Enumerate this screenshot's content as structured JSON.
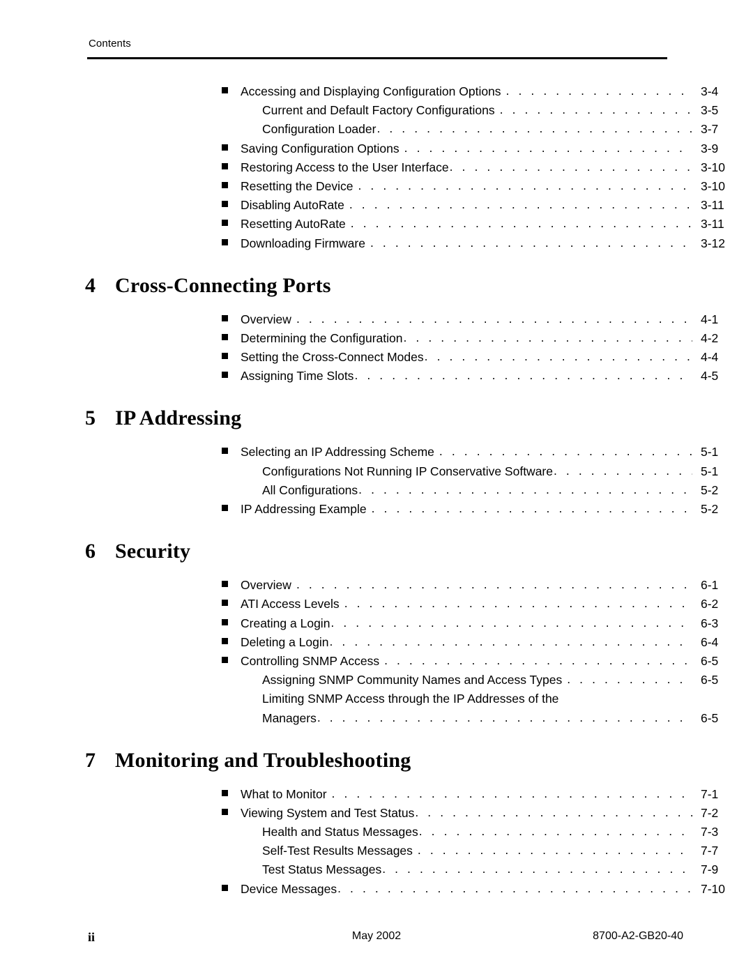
{
  "header": {
    "running_head": "Contents"
  },
  "toc": {
    "blocks": [
      {
        "type": "entries",
        "entries": [
          {
            "level": 1,
            "label": "Accessing and Displaying Configuration Options",
            "gap": true,
            "page": "3-4"
          },
          {
            "level": 2,
            "label": "Current and Default Factory Configurations",
            "gap": true,
            "page": "3-5"
          },
          {
            "level": 2,
            "label": "Configuration Loader",
            "gap": false,
            "page": "3-7"
          },
          {
            "level": 1,
            "label": "Saving Configuration Options",
            "gap": true,
            "page": "3-9"
          },
          {
            "level": 1,
            "label": "Restoring Access to the User Interface",
            "gap": false,
            "page": "3-10"
          },
          {
            "level": 1,
            "label": "Resetting the Device",
            "gap": true,
            "page": "3-10"
          },
          {
            "level": 1,
            "label": "Disabling AutoRate",
            "gap": true,
            "page": "3-11"
          },
          {
            "level": 1,
            "label": "Resetting AutoRate",
            "gap": true,
            "page": "3-11"
          },
          {
            "level": 1,
            "label": "Downloading Firmware",
            "gap": true,
            "page": "3-12"
          }
        ]
      },
      {
        "type": "chapter",
        "number": "4",
        "title": "Cross-Connecting Ports",
        "entries": [
          {
            "level": 1,
            "label": "Overview",
            "gap": true,
            "page": "4-1"
          },
          {
            "level": 1,
            "label": "Determining the Configuration",
            "gap": false,
            "page": "4-2"
          },
          {
            "level": 1,
            "label": "Setting the Cross-Connect Modes",
            "gap": false,
            "page": "4-4"
          },
          {
            "level": 1,
            "label": "Assigning Time Slots",
            "gap": false,
            "page": "4-5"
          }
        ]
      },
      {
        "type": "chapter",
        "number": "5",
        "title": "IP Addressing",
        "entries": [
          {
            "level": 1,
            "label": "Selecting an IP Addressing Scheme",
            "gap": true,
            "page": "5-1"
          },
          {
            "level": 2,
            "label": "Configurations Not Running IP Conservative Software",
            "gap": false,
            "page": "5-1"
          },
          {
            "level": 2,
            "label": "All Configurations",
            "gap": false,
            "page": "5-2"
          },
          {
            "level": 1,
            "label": "IP Addressing Example",
            "gap": true,
            "page": "5-2"
          }
        ]
      },
      {
        "type": "chapter",
        "number": "6",
        "title": "Security",
        "entries": [
          {
            "level": 1,
            "label": "Overview",
            "gap": true,
            "page": "6-1"
          },
          {
            "level": 1,
            "label": "ATI Access Levels",
            "gap": true,
            "page": "6-2"
          },
          {
            "level": 1,
            "label": "Creating a Login",
            "gap": false,
            "page": "6-3"
          },
          {
            "level": 1,
            "label": "Deleting a Login",
            "gap": false,
            "page": "6-4"
          },
          {
            "level": 1,
            "label": "Controlling SNMP Access",
            "gap": true,
            "page": "6-5"
          },
          {
            "level": 2,
            "label": "Assigning SNMP Community Names and Access Types",
            "gap": true,
            "page": "6-5"
          },
          {
            "level": 2,
            "label": "Limiting SNMP Access through the IP Addresses of the",
            "gap": false,
            "page": "",
            "continued": true
          },
          {
            "level": 2,
            "label": "Managers",
            "gap": false,
            "page": "6-5"
          }
        ]
      },
      {
        "type": "chapter",
        "number": "7",
        "title": "Monitoring and Troubleshooting",
        "entries": [
          {
            "level": 1,
            "label": "What to Monitor",
            "gap": true,
            "page": "7-1"
          },
          {
            "level": 1,
            "label": "Viewing System and Test Status",
            "gap": false,
            "page": "7-2"
          },
          {
            "level": 2,
            "label": "Health and Status Messages",
            "gap": false,
            "page": "7-3"
          },
          {
            "level": 2,
            "label": "Self-Test Results Messages",
            "gap": true,
            "page": "7-7"
          },
          {
            "level": 2,
            "label": "Test Status Messages",
            "gap": false,
            "page": "7-9"
          },
          {
            "level": 1,
            "label": "Device Messages",
            "gap": false,
            "page": "7-10"
          }
        ]
      }
    ],
    "leader_dots": ". . . . . . . . . . . . . . . . . . . . . . . . . . . . . . . . . . . . . . . . . . . . . . . . . . . . . . . . . . . . . . . . . . . . . . . . . . . ."
  },
  "footer": {
    "page_label": "ii",
    "date": "May 2002",
    "doc_number": "8700-A2-GB20-40"
  }
}
